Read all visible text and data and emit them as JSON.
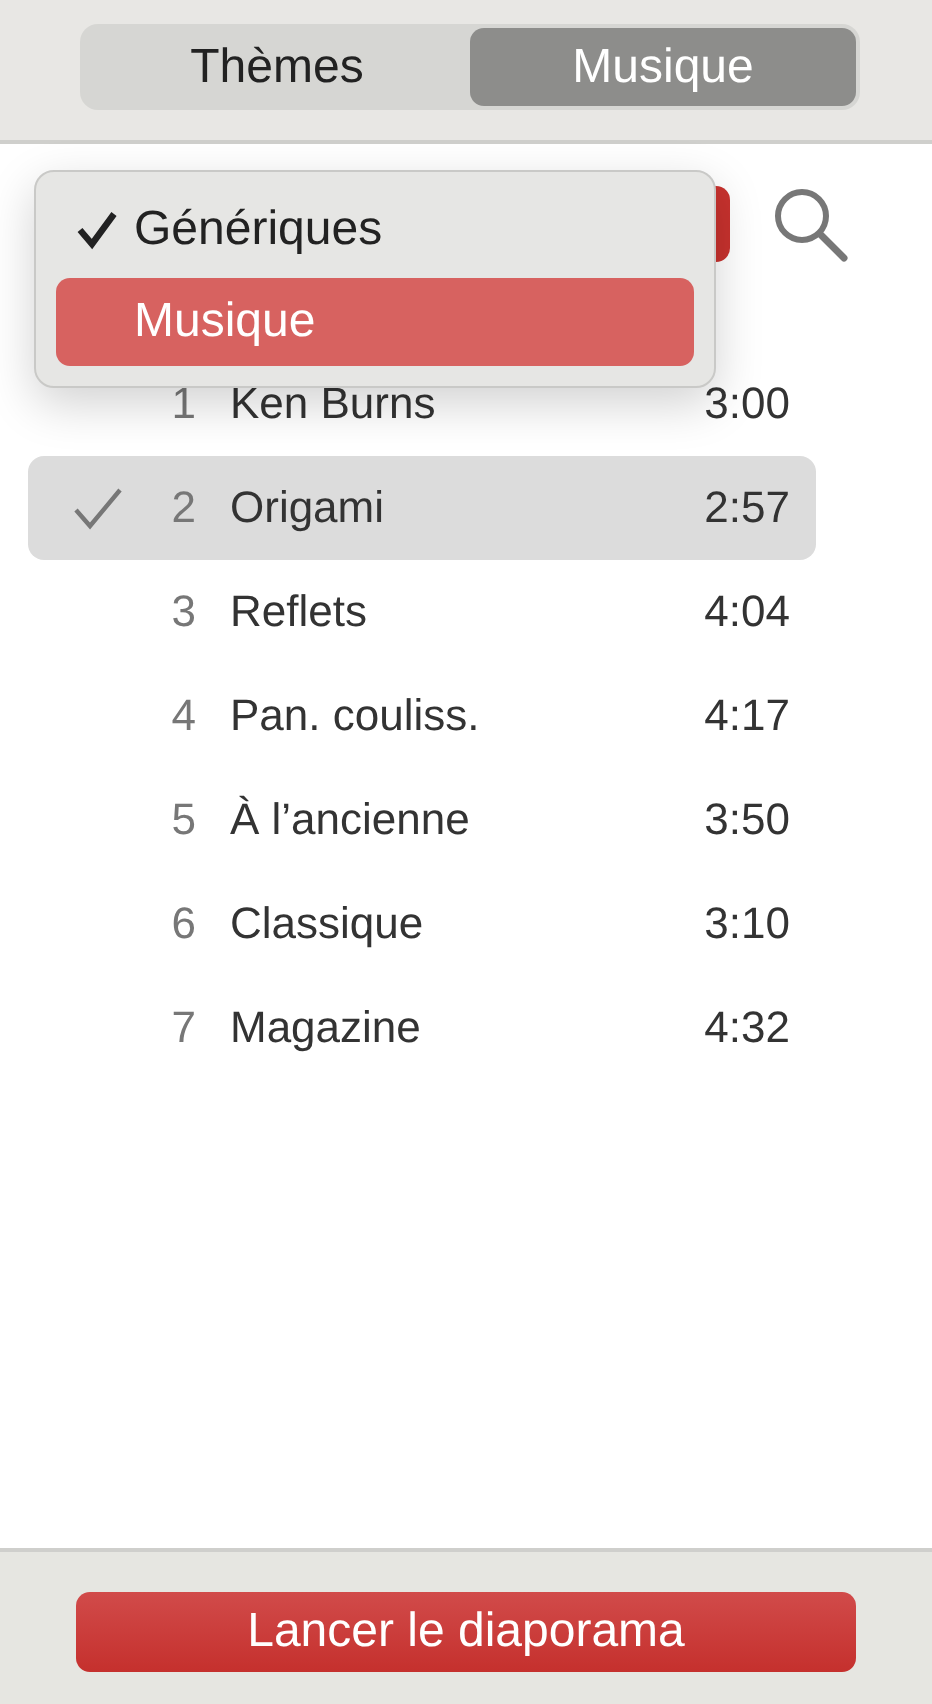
{
  "tabs": [
    {
      "label": "Thèmes",
      "selected": false
    },
    {
      "label": "Musique",
      "selected": true
    }
  ],
  "menu": {
    "items": [
      {
        "label": "Génériques",
        "checked": true,
        "selected": false
      },
      {
        "label": "Musique",
        "checked": false,
        "selected": true
      }
    ]
  },
  "tracks": [
    {
      "number": "1",
      "name": "Ken Burns",
      "duration": "3:00",
      "checked": false,
      "selected": false
    },
    {
      "number": "2",
      "name": "Origami",
      "duration": "2:57",
      "checked": true,
      "selected": true
    },
    {
      "number": "3",
      "name": "Reflets",
      "duration": "4:04",
      "checked": false,
      "selected": false
    },
    {
      "number": "4",
      "name": "Pan. couliss.",
      "duration": "4:17",
      "checked": false,
      "selected": false
    },
    {
      "number": "5",
      "name": "À l’ancienne",
      "duration": "3:50",
      "checked": false,
      "selected": false
    },
    {
      "number": "6",
      "name": "Classique",
      "duration": "3:10",
      "checked": false,
      "selected": false
    },
    {
      "number": "7",
      "name": "Magazine",
      "duration": "4:32",
      "checked": false,
      "selected": false
    }
  ],
  "start_button": {
    "label": "Lancer le diaporama"
  }
}
